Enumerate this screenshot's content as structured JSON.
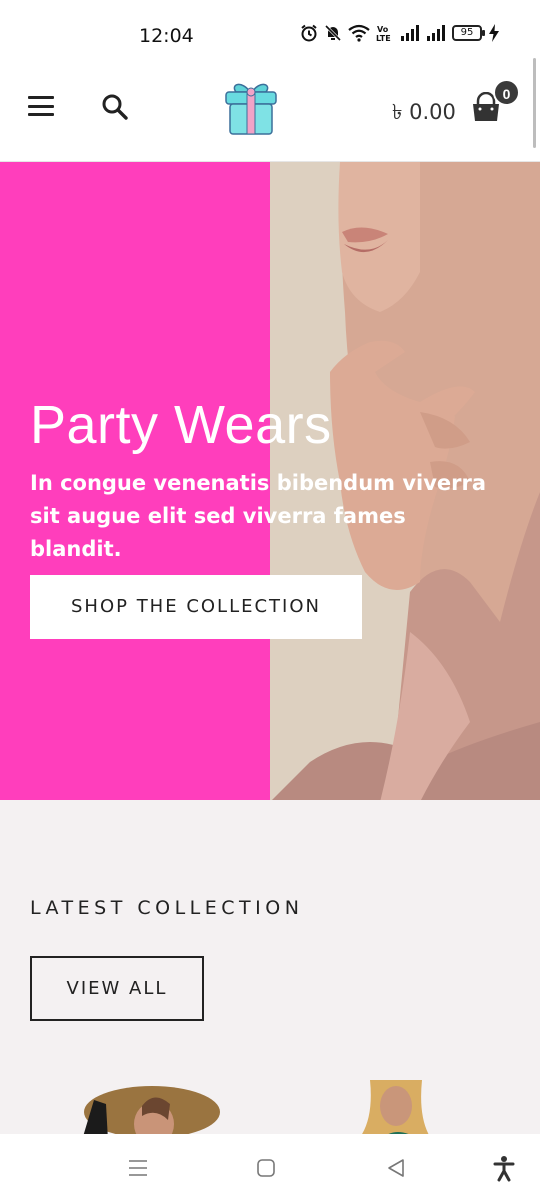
{
  "status_bar": {
    "time": "12:04",
    "battery": "95",
    "icons": [
      "alarm-icon",
      "mute-icon",
      "wifi-icon",
      "volte-icon",
      "signal-icon",
      "signal-icon",
      "battery-icon",
      "charging-icon"
    ]
  },
  "header": {
    "menu_icon": "hamburger-icon",
    "search_icon": "search-icon",
    "logo_icon": "gift-box-logo",
    "cart_total": "৳ 0.00",
    "cart_icon": "shopping-bag-icon",
    "cart_count": "0"
  },
  "hero": {
    "title": "Party Wears",
    "text": "In congue venenatis bibendum viverra sit augue elit sed viverra fames blandit.",
    "button_label": "SHOP THE COLLECTION",
    "accent_color": "#ff3ebc",
    "photo_bg_color": "#ddd0c0"
  },
  "latest": {
    "title": "LATEST COLLECTION",
    "view_all_label": "VIEW ALL",
    "background_color": "#f4f1f2"
  },
  "nav_bar": {
    "icons": [
      "recents-icon",
      "home-icon",
      "back-icon",
      "accessibility-icon"
    ]
  }
}
